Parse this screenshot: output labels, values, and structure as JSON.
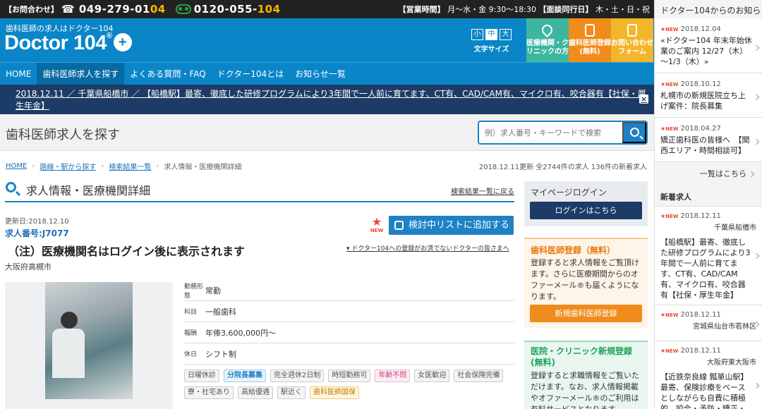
{
  "contact": {
    "label": "【お問合わせ】",
    "phone1_a": "049-279-01",
    "phone1_b": "04",
    "phone2_a": "0120-055-",
    "phone2_b": "104",
    "hours_label": "【営業時間】",
    "hours_value": "月～水・金 9:30～18:30",
    "closed_label": "【面談同行日】",
    "closed_value": "木・土・日・祝"
  },
  "header": {
    "tagline": "歯科医師の求人はドクター104",
    "logo_text": "Doctor 104",
    "logo_mark": "®",
    "plus": "+",
    "font_sizes": [
      "小",
      "中",
      "大"
    ],
    "font_size_label": "文字サイズ",
    "btn_clinic": "医療機関・クリニックの方",
    "btn_register": "歯科医師登録(無料)",
    "btn_contact": "お問い合わせフォーム"
  },
  "nav": [
    "HOME",
    "歯科医師求人を探す",
    "よくある質問・FAQ",
    "ドクター104とは",
    "お知らせ一覧"
  ],
  "ticker": {
    "text": "2018.12.11 ／ 千葉県船橋市 ／ 【船橋駅】最寄、徹底した研修プログラムにより3年間で一人前に育てます、CT有、CAD/CAM有、マイクロ有、咬合器有【社保・厚生年金】",
    "close": "×"
  },
  "search": {
    "title": "歯科医師求人を探す",
    "placeholder": "例）求人番号・キーワードで検索"
  },
  "breadcrumb": [
    "HOME",
    "路線・駅から探す",
    "検索結果一覧",
    "求人情報・医療機関詳細"
  ],
  "update_info": "2018.12.11更新 全2744件の求人 136件の新着求人",
  "detail": {
    "section_title": "求人情報・医療機関詳細",
    "back_link": "検索結果一覧に戻る",
    "updated": "更新日:2018.12.10",
    "job_number": "求人番号:J7077",
    "job_name": "（注）医療機関名はログイン後に表示されます",
    "prefecture": "大阪府高槻市",
    "new_badge": "NEW",
    "add_list": "検討中リストに追加する",
    "guide_link": "ドクター104への登録がお済でないドクターの皆さまへ",
    "info": [
      {
        "k": "勤務形態",
        "v": "常勤"
      },
      {
        "k": "科目",
        "v": "一般歯科"
      },
      {
        "k": "報酬",
        "v": "年俸3,600,000円～"
      },
      {
        "k": "休日",
        "v": "シフト制"
      }
    ],
    "tags": [
      {
        "t": "日曜休診",
        "s": ""
      },
      {
        "t": "分院長募集",
        "s": "b"
      },
      {
        "t": "完全週休2日制",
        "s": ""
      },
      {
        "t": "時短勤務可",
        "s": ""
      },
      {
        "t": "年齢不問",
        "s": "p"
      },
      {
        "t": "女医歓迎",
        "s": ""
      },
      {
        "t": "社会保険完備",
        "s": ""
      },
      {
        "t": "寮・社宅あり",
        "s": ""
      },
      {
        "t": "高給優遇",
        "s": ""
      },
      {
        "t": "駅近く",
        "s": ""
      },
      {
        "t": "歯科医師国保",
        "s": "o"
      }
    ]
  },
  "side": {
    "mypage_title": "マイページログイン",
    "login_btn": "ログインはこちら",
    "reg_title": "歯科医師登録（無料）",
    "reg_text": "登録すると求人情報をご覧頂けます。さらに医療期間からのオファーメール®も届くようになります。",
    "reg_btn": "新規歯科医師登録",
    "clinic_title": "医院・クリニック新規登録(無料)",
    "clinic_text": "登録すると求職情報をご覧いただけます。なお、求人情報掲載やオファーメール®のご利用は有料サービスとなります。"
  },
  "news": {
    "heading": "ドクター104からのお知らせ",
    "new_label": "NEW",
    "items": [
      {
        "date": "2018.12.04",
        "text": "«ドクター104 年末年始休業のご案内 12/27（木）～1/3（木）»"
      },
      {
        "date": "2018.10.12",
        "text": "札幌市の新規医院立ち上げ案件：院長募集"
      },
      {
        "date": "2018.04.27",
        "text": "矯正歯科医の皆様へ　【関西エリア・時間相談可】"
      }
    ],
    "more": "一覧はこちら"
  },
  "newjobs": {
    "heading": "新着求人",
    "items": [
      {
        "date": "2018.12.11",
        "loc": "千葉県船橋市",
        "text": "【船橋駅】最寄、徹底した研修プログラムにより3年間で一人前に育てます、CT有、CAD/CAM有、マイクロ有、咬合器有【社保・厚生年金】"
      },
      {
        "date": "2018.12.11",
        "loc": "宮城県仙台市若林区",
        "text": ""
      },
      {
        "date": "2018.12.11",
        "loc": "大阪府東大阪市",
        "text": "【近鉄奈良線 瓢箪山駅】最寄、保険診療をベースとしながらも自費に積極的。咬合・予防・矯正・審美に"
      }
    ]
  }
}
